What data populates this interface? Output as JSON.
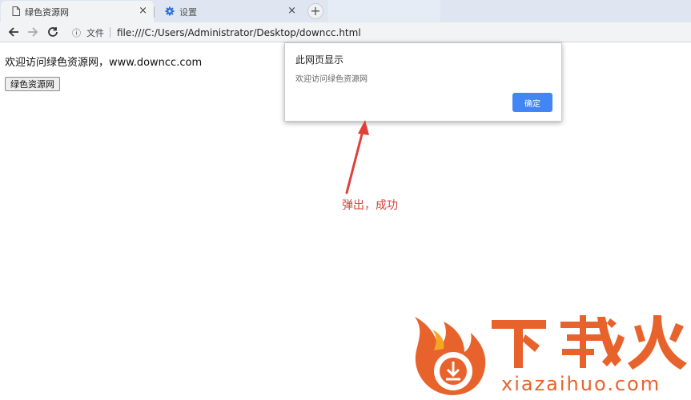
{
  "browser": {
    "tabs": [
      {
        "title": "绿色资源网",
        "icon": "page-icon",
        "active": true
      },
      {
        "title": "设置",
        "icon": "gear-icon",
        "active": false
      }
    ],
    "close_glyph": "×",
    "new_tab_glyph": "+",
    "back_glyph": "←",
    "forward_glyph": "→",
    "reload_glyph": "↻",
    "info_glyph": "ⓘ",
    "security_label": "文件",
    "url": "file:///C:/Users/Administrator/Desktop/downcc.html"
  },
  "page": {
    "welcome_text": "欢迎访问绿色资源网，www.downcc.com",
    "button_label": "绿色资源网"
  },
  "dialog": {
    "title": "此网页显示",
    "message": "欢迎访问绿色资源网",
    "ok_label": "确定"
  },
  "annotation": {
    "text": "弹出，成功",
    "color": "#d9403b"
  },
  "watermark": {
    "brand": "下载火",
    "url": "xiazaihuo.com",
    "colors": {
      "orange": "#e8622c",
      "yellow": "#f5a623"
    }
  },
  "colors": {
    "accent": "#4285f4",
    "tabstrip": "#dfe6f1",
    "toolbar": "#f2f3f5"
  }
}
